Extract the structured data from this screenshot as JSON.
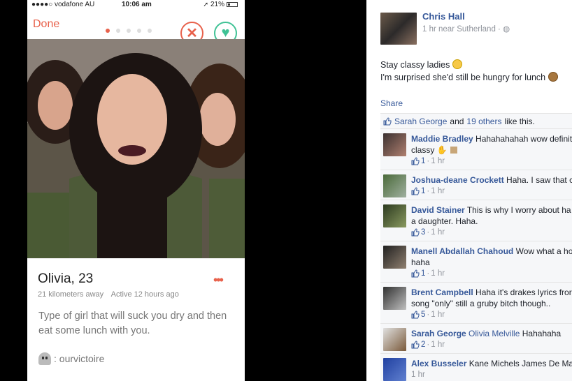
{
  "tinder": {
    "status": {
      "carrier": "●●●●○ vodafone AU",
      "time": "10:06 am",
      "battery": "21%"
    },
    "done_label": "Done",
    "nope_icon": "x-circle-icon",
    "like_icon": "heart-circle-icon",
    "page_dots": [
      true,
      false,
      false,
      false,
      false
    ],
    "name_age": "Olivia, 23",
    "more_label": "•••",
    "distance": "21 kilometers away",
    "active": "Active 12 hours ago",
    "bio": "Type of girl that will suck you dry and then eat some lunch with you.",
    "instagram": ": ourvictoire"
  },
  "facebook": {
    "poster": "Chris Hall",
    "post_meta": "1 hr near Sutherland · ",
    "post_line1": "Stay classy ladies",
    "post_line2": "I'm surprised she'd still be hungry for lunch",
    "share_label": "Share",
    "likes_name": "Sarah George",
    "likes_and": "and",
    "likes_others": "19 others",
    "likes_tail": "like this.",
    "comments": [
      {
        "author": "Maddie Bradley",
        "text": "Hahahahahah wow definit",
        "line2": "classy",
        "likes": "1",
        "time": "1 hr",
        "colors": [
          "#3a3030",
          "#b08070"
        ]
      },
      {
        "author": "Joshua-deane Crockett",
        "text": "Haha. I saw that c",
        "line2": "",
        "likes": "1",
        "time": "1 hr",
        "colors": [
          "#4a6a3a",
          "#a0b0a0"
        ]
      },
      {
        "author": "David Stainer",
        "text": "This is why I worry about ha",
        "line2": "a daughter. Haha.",
        "likes": "3",
        "time": "1 hr",
        "colors": [
          "#2c3a20",
          "#8a9a60"
        ]
      },
      {
        "author": "Manell Abdallah Chahoud",
        "text": "Wow what a ho",
        "line2": "haha",
        "likes": "1",
        "time": "1 hr",
        "colors": [
          "#202020",
          "#908070"
        ]
      },
      {
        "author": "Brent Campbell",
        "text": "Haha it's drakes lyrics fror",
        "line2": "song \"only\" still a gruby bitch though..",
        "likes": "5",
        "time": "1 hr",
        "colors": [
          "#303030",
          "#c0c0c0"
        ]
      },
      {
        "author": "Sarah George",
        "text": "Olivia Melville",
        "text2": "Hahahaha",
        "line2": "",
        "likes": "2",
        "time": "1 hr",
        "colors": [
          "#e0e0e0",
          "#7a5a3a"
        ]
      },
      {
        "author": "Alex Busseler",
        "text": "Kane Michels James De Ma",
        "line2": "",
        "likes": "",
        "time": "1 hr",
        "colors": [
          "#2040a0",
          "#6080d0"
        ]
      }
    ]
  }
}
